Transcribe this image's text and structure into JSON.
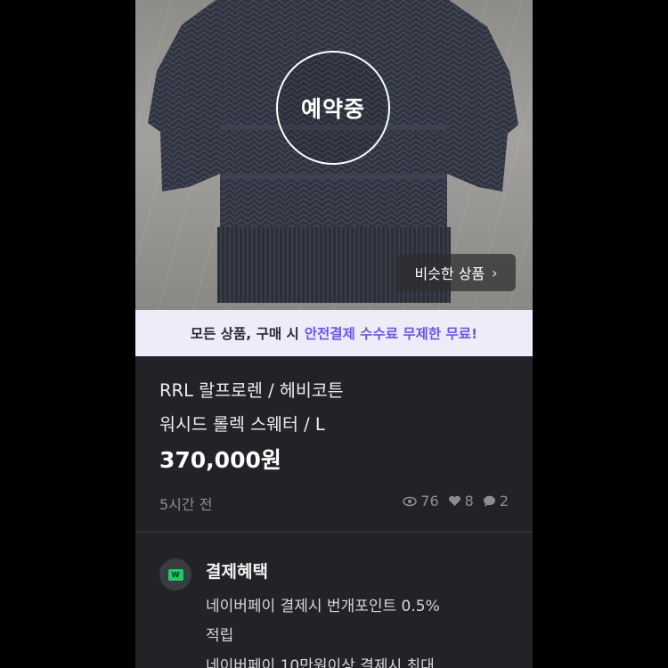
{
  "product_image": {
    "status_badge": "예약중",
    "similar_button": "비슷한 상품",
    "similar_chevron": "›"
  },
  "promo": {
    "text_plain": "모든 상품, 구매 시",
    "text_highlight": "안전결제 수수료 무제한 무료!"
  },
  "product": {
    "title_line1": "RRL 랄프로렌 / 헤비코튼",
    "title_line2": "워시드 롤렉 스웨터 / L",
    "price": "370,000원",
    "posted": "5시간 전",
    "views": "76",
    "likes": "8",
    "chats": "2"
  },
  "payment": {
    "icon_text": "W",
    "title": "결제혜택",
    "lines": [
      "네이버페이 결제시 번개포인트 0.5%",
      "적립",
      "네이버페이 10만원이상 결제시 최대"
    ]
  },
  "colors": {
    "background": "#222327",
    "accent": "#6c55e6",
    "promo_bg": "#ecedf8",
    "pay_green": "#19ce60"
  }
}
